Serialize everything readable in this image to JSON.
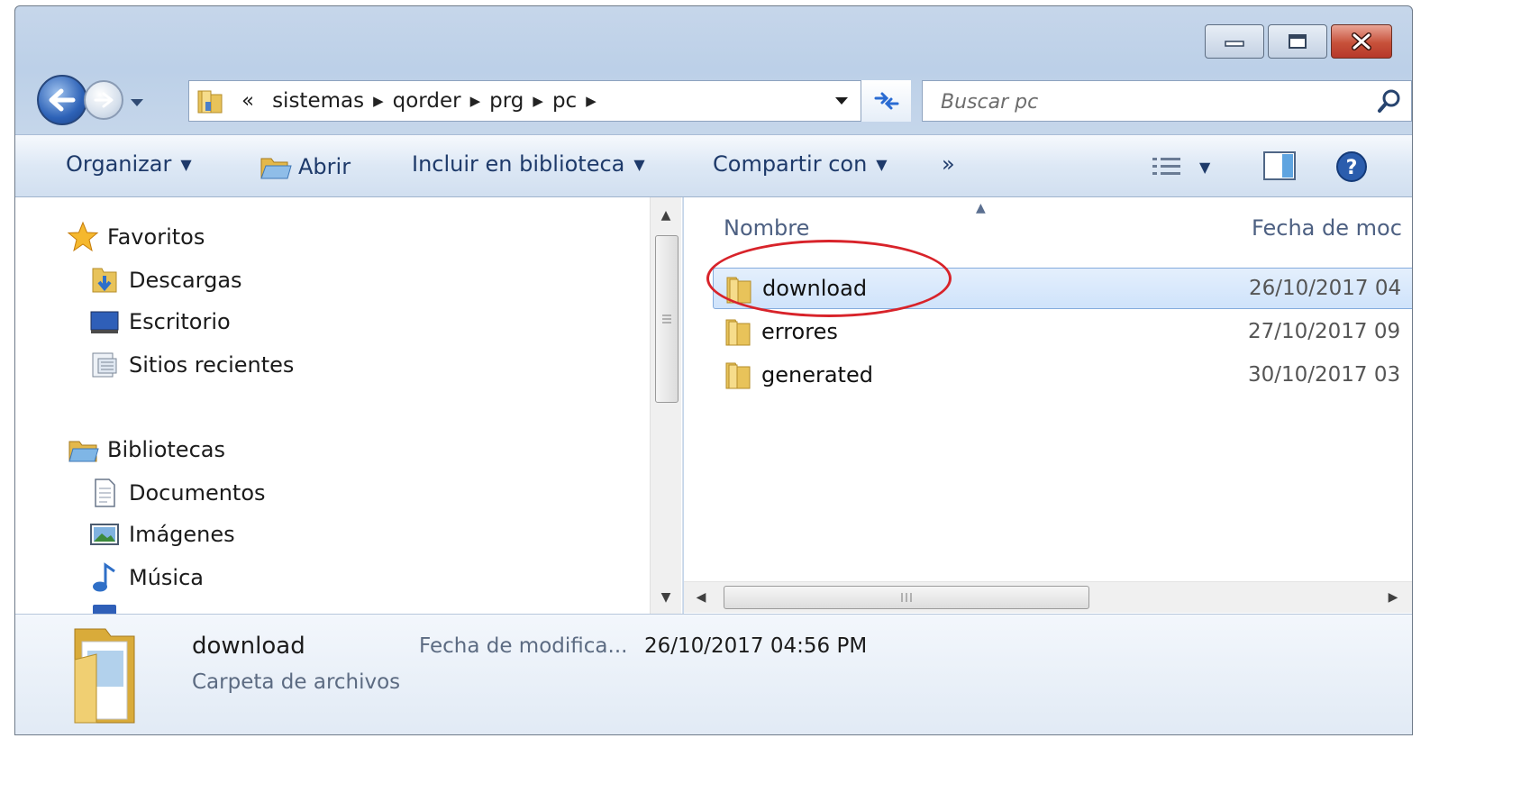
{
  "window": {
    "caption_buttons": [
      "minimize-icon",
      "maximize-icon",
      "close-icon"
    ]
  },
  "address_bar": {
    "overflow": "«",
    "crumbs": [
      "sistemas",
      "qorder",
      "prg",
      "pc"
    ]
  },
  "search": {
    "placeholder": "Buscar pc"
  },
  "toolbar": {
    "organize": "Organizar",
    "open": "Abrir",
    "include_library": "Incluir en biblioteca",
    "share_with": "Compartir con",
    "more": "»"
  },
  "nav_pane": {
    "favorites": {
      "label": "Favoritos",
      "icon": "star-icon"
    },
    "favorites_items": [
      {
        "label": "Descargas",
        "icon": "downloads-folder-icon"
      },
      {
        "label": "Escritorio",
        "icon": "desktop-icon"
      },
      {
        "label": "Sitios recientes",
        "icon": "recent-places-icon"
      }
    ],
    "libraries": {
      "label": "Bibliotecas",
      "icon": "libraries-icon"
    },
    "libraries_items": [
      {
        "label": "Documentos",
        "icon": "documents-icon"
      },
      {
        "label": "Imágenes",
        "icon": "pictures-icon"
      },
      {
        "label": "Música",
        "icon": "music-icon"
      }
    ]
  },
  "file_list": {
    "columns": [
      "Nombre",
      "Fecha de moc"
    ],
    "rows": [
      {
        "name": "download",
        "date": "26/10/2017 04",
        "selected": true
      },
      {
        "name": "errores",
        "date": "27/10/2017 09",
        "selected": false
      },
      {
        "name": "generated",
        "date": "30/10/2017 03",
        "selected": false
      }
    ]
  },
  "details": {
    "name": "download",
    "type": "Carpeta de archivos",
    "date_label": "Fecha de modifica...",
    "date_value": "26/10/2017 04:56 PM"
  },
  "colors": {
    "annotation": "#d8232a",
    "selection": "#cfe3fb",
    "toolbar_text": "#1e3a6a"
  }
}
